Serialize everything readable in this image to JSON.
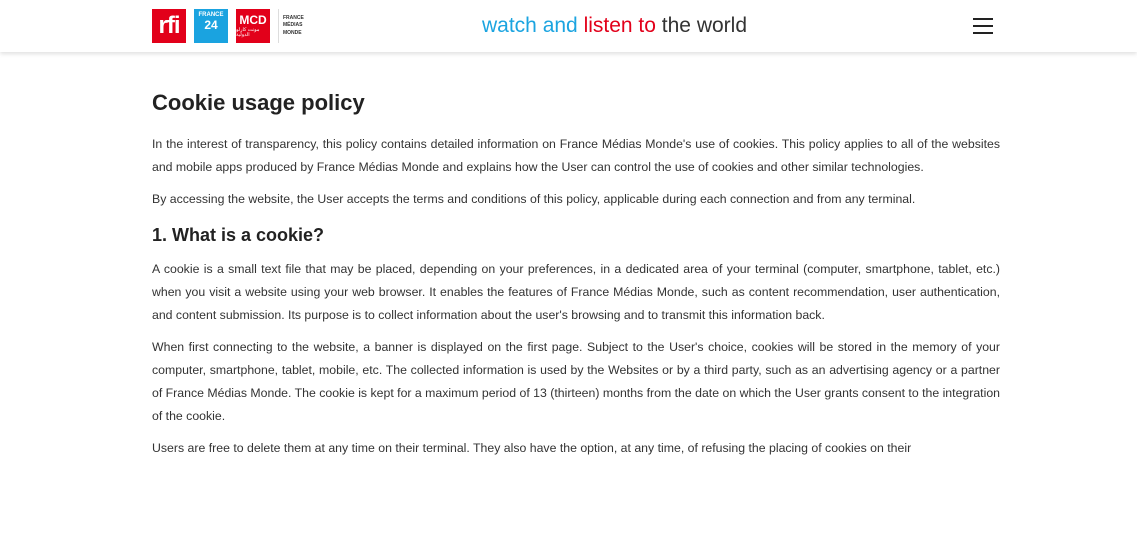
{
  "header": {
    "logos": {
      "rfi": "rfi",
      "f24_top": "FRANCE",
      "f24_num": "24",
      "mcd": "MCD",
      "mcd_ar": "مونت كارلو الدولية",
      "fmm_line1": "FRANCE",
      "fmm_line2": "MÉDIAS",
      "fmm_line3": "MONDE"
    },
    "tagline": {
      "part1": "watch and",
      "part2": "listen to",
      "part3": "the world"
    },
    "menu_icon": "hamburger-menu-icon"
  },
  "content": {
    "title": "Cookie usage policy",
    "intro1": "In the interest of transparency, this policy contains detailed information on France Médias Monde's use of cookies. This policy applies to all of the websites and mobile apps produced by France Médias Monde and explains how the User can control the use of cookies and other similar technologies.",
    "intro2": "By accessing the website, the User accepts the terms and conditions of this policy, applicable during each connection and from any terminal.",
    "section1_title": "1. What is a cookie?",
    "section1_p1": "A cookie is a small text file that may be placed, depending on your preferences, in a dedicated area of your terminal (computer, smartphone, tablet, etc.) when you visit a website using your web browser. It enables the features of France Médias Monde, such as content recommendation, user authentication, and content submission. Its purpose is to collect information about the user's browsing and to transmit this information back.",
    "section1_p2": "When first connecting to the website, a banner is displayed on the first page. Subject to the User's choice, cookies will be stored in the memory of your computer, smartphone, tablet, mobile, etc. The collected information is used by the Websites or by a third party, such as an advertising agency or a partner of France Médias Monde. The cookie is kept for a maximum period of 13 (thirteen) months from the date on which the User grants consent to the integration of the cookie.",
    "section1_p3": "Users are free to delete them at any time on their terminal. They also have the option, at any time, of refusing the placing of cookies on their"
  },
  "colors": {
    "rfi_red": "#e2001a",
    "f24_blue": "#1aa3e0",
    "tagline_blue": "#1ba4e0",
    "tagline_red": "#e2001a"
  }
}
